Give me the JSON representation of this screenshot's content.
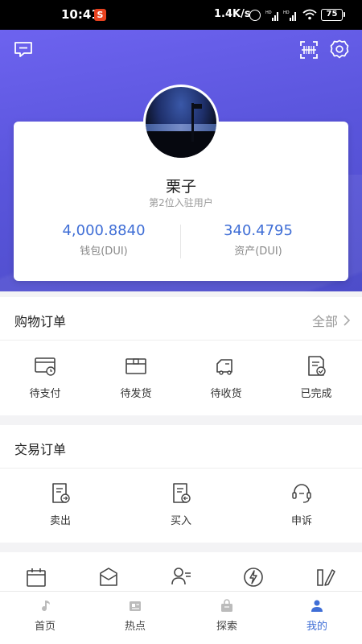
{
  "status_bar": {
    "time": "10:41",
    "app_icon_letter": "S",
    "network_speed": "1.4K/s",
    "signal_badge_1": "HD",
    "signal_badge_2": "HD",
    "battery": "75"
  },
  "header": {
    "left_icon": "message-icon",
    "right_icons": [
      "scan-icon",
      "gear-icon"
    ]
  },
  "profile": {
    "name": "栗子",
    "subtitle": "第2位入驻用户",
    "wallet": {
      "value": "4,000.8840",
      "label": "钱包(DUI)"
    },
    "assets": {
      "value": "340.4795",
      "label": "资产(DUI)"
    }
  },
  "shopping_orders": {
    "title": "购物订单",
    "more_label": "全部",
    "items": [
      {
        "label": "待支付",
        "icon": "card-clock-icon"
      },
      {
        "label": "待发货",
        "icon": "box-icon"
      },
      {
        "label": "待收货",
        "icon": "truck-icon"
      },
      {
        "label": "已完成",
        "icon": "document-check-icon"
      }
    ]
  },
  "trade_orders": {
    "title": "交易订单",
    "items": [
      {
        "label": "卖出",
        "icon": "document-out-icon"
      },
      {
        "label": "买入",
        "icon": "document-in-icon"
      },
      {
        "label": "申诉",
        "icon": "headset-icon"
      }
    ]
  },
  "tools_row": {
    "icons": [
      "calendar-icon",
      "envelope-icon",
      "user-card-icon",
      "lightning-icon",
      "edit-icon"
    ]
  },
  "bottom_nav": {
    "items": [
      {
        "label": "首页",
        "icon": "music-note-icon"
      },
      {
        "label": "热点",
        "icon": "news-icon"
      },
      {
        "label": "探索",
        "icon": "bag-icon"
      },
      {
        "label": "我的",
        "icon": "person-icon"
      }
    ],
    "active_index": 3
  },
  "colors": {
    "accent": "#3f6ed6",
    "header_gradient_start": "#6d63ef",
    "header_gradient_end": "#4d4dc9"
  }
}
